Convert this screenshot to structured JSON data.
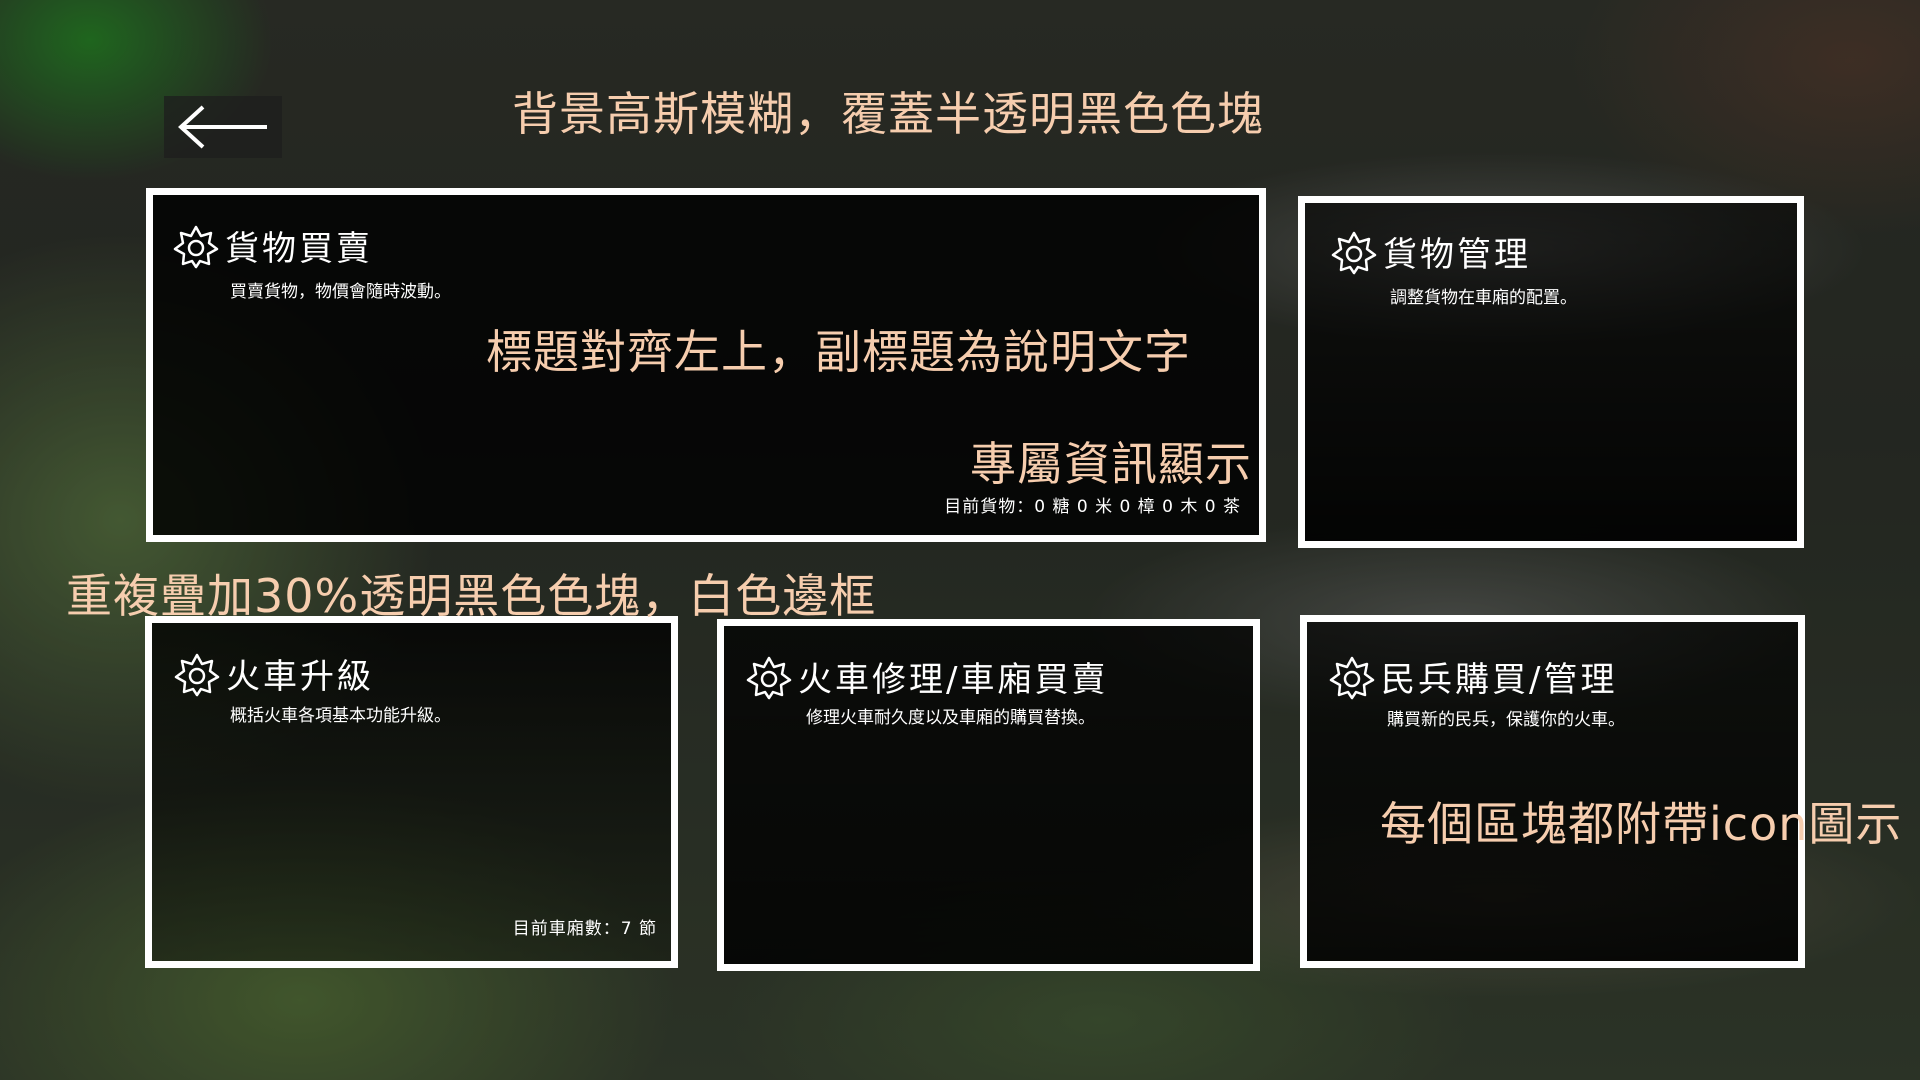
{
  "background": {
    "note_color": "#f6cdae",
    "card_border_color": "#ffffff"
  },
  "back_button": {
    "icon": "arrow-left-icon"
  },
  "annotations": {
    "top": "背景高斯模糊，覆蓋半透明黑色色塊",
    "title_note": "標題對齊左上，副標題為說明文字",
    "info_note": "專屬資訊顯示",
    "overlay_note": "重複疊加30%透明黑色色塊，白色邊框",
    "icon_note": "每個區塊都附帶icon圖示"
  },
  "cards": [
    {
      "icon": "gear-flower-icon",
      "title": "貨物買賣",
      "subtitle": "買賣貨物，物價會隨時波動。",
      "info": "目前貨物：0 糖 0 米 0 樟 0 木 0 茶"
    },
    {
      "icon": "gear-flower-icon",
      "title": "貨物管理",
      "subtitle": "調整貨物在車廂的配置。"
    },
    {
      "icon": "gear-flower-icon",
      "title": "火車升級",
      "subtitle": "概括火車各項基本功能升級。",
      "info": "目前車廂數：7 節"
    },
    {
      "icon": "gear-flower-icon",
      "title": "火車修理/車廂買賣",
      "subtitle": "修理火車耐久度以及車廂的購買替換。"
    },
    {
      "icon": "gear-flower-icon",
      "title": "民兵購買/管理",
      "subtitle": "購買新的民兵，保護你的火車。"
    }
  ]
}
